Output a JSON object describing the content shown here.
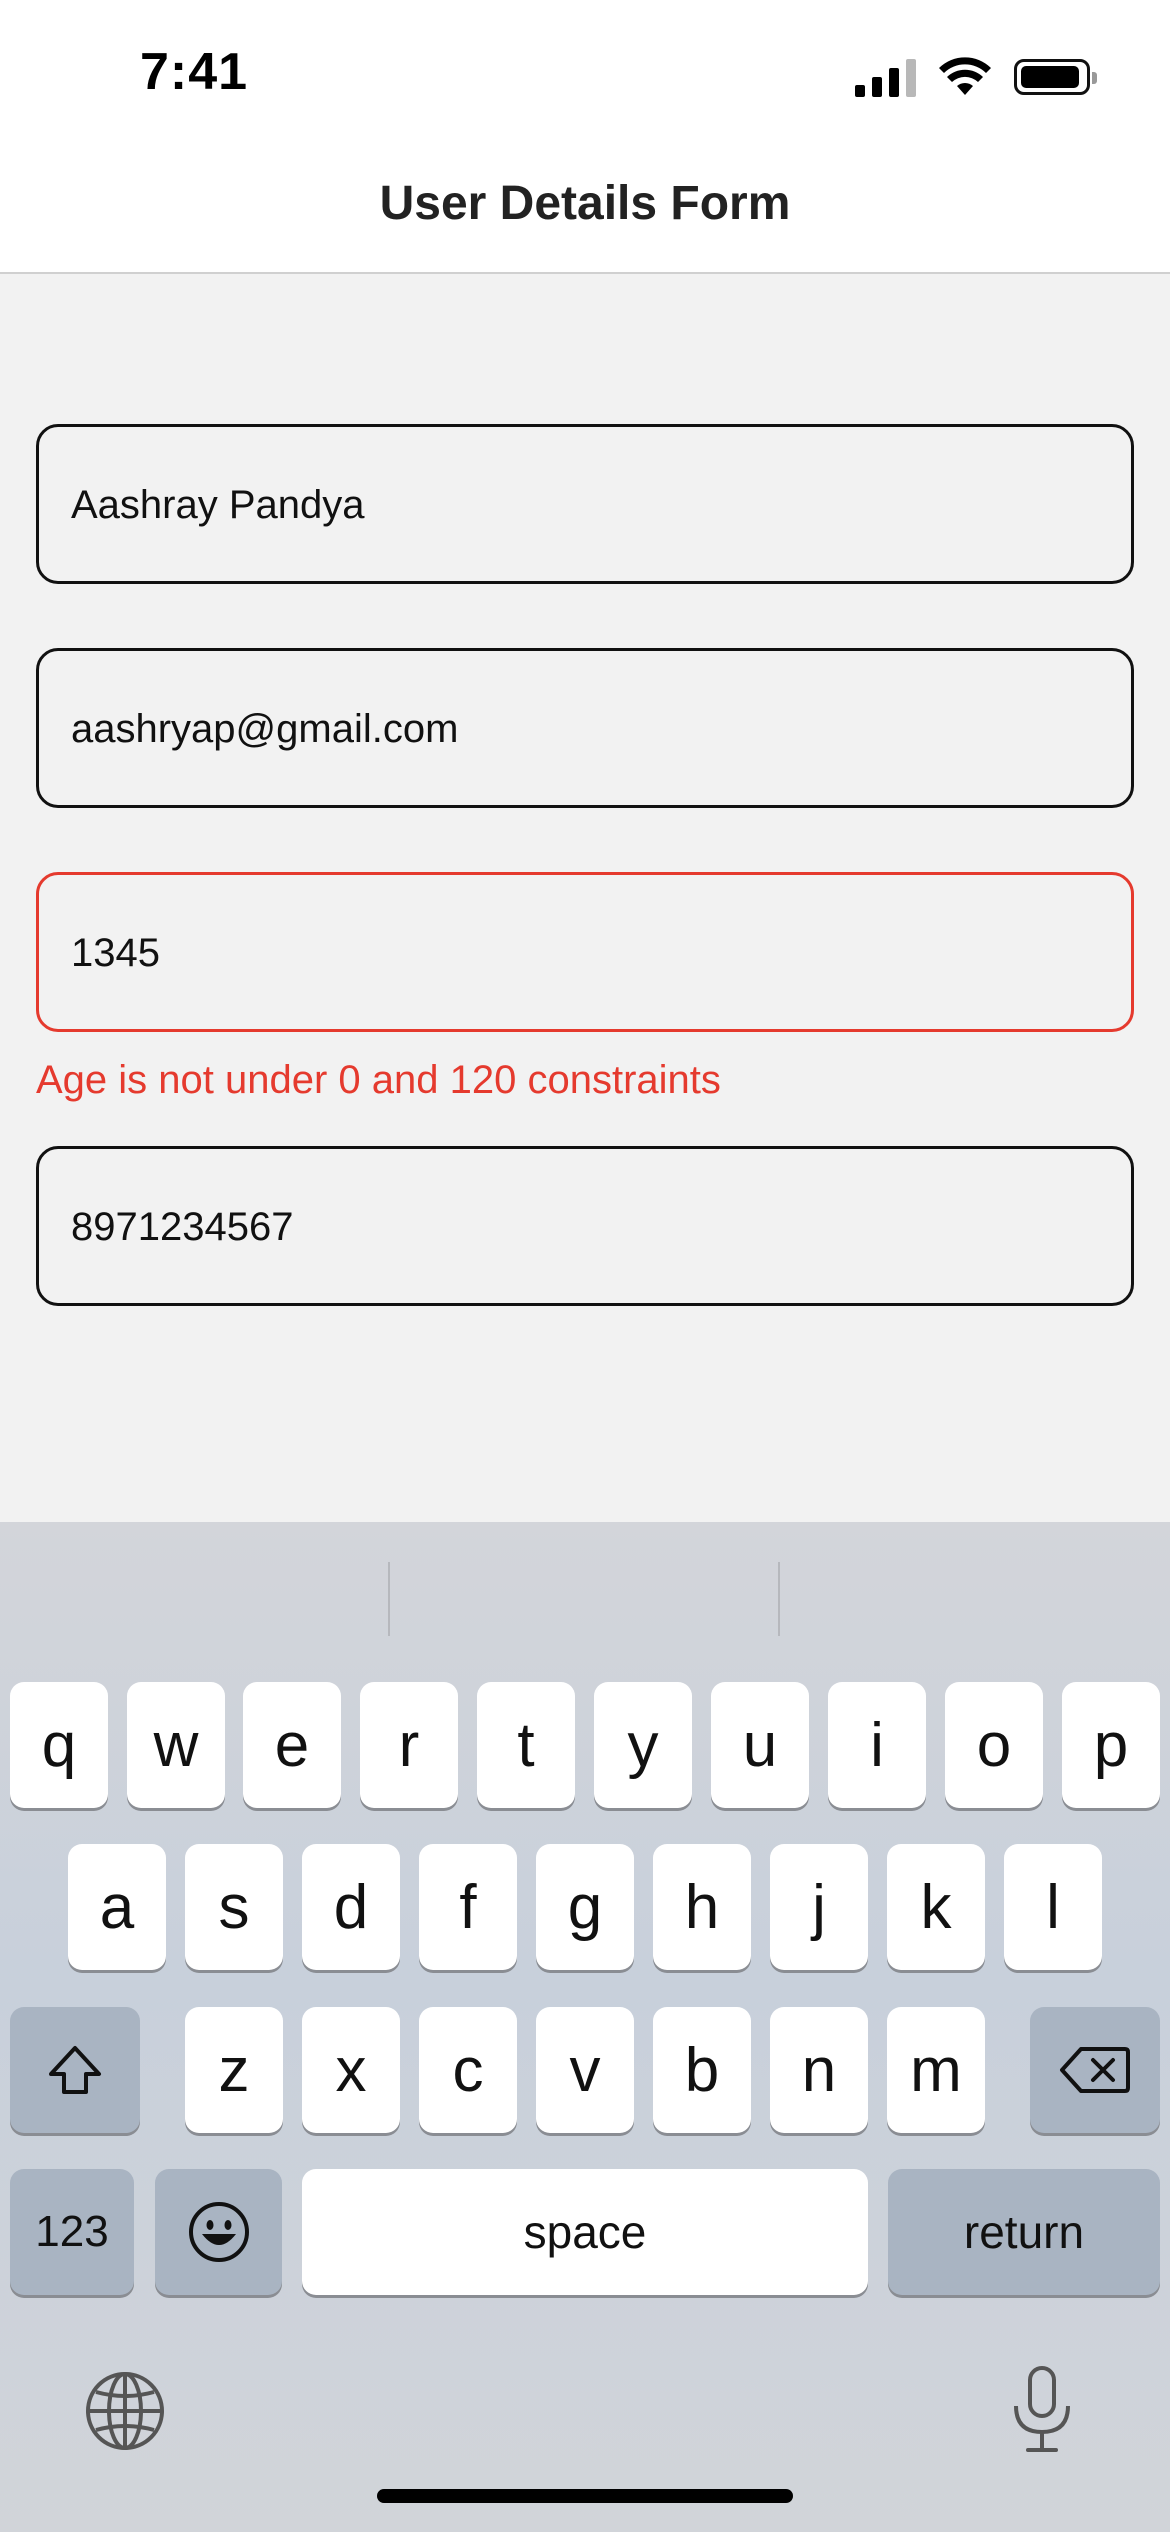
{
  "status_bar": {
    "time": "7:41"
  },
  "nav": {
    "title": "User Details Form"
  },
  "form": {
    "name_value": "Aashray Pandya",
    "email_value": "aashryap@gmail.com",
    "age_value": "1345",
    "age_error": "Age is not under 0 and 120 constraints",
    "phone_value": "8971234567"
  },
  "keyboard": {
    "row1": [
      "q",
      "w",
      "e",
      "r",
      "t",
      "y",
      "u",
      "i",
      "o",
      "p"
    ],
    "row2": [
      "a",
      "s",
      "d",
      "f",
      "g",
      "h",
      "j",
      "k",
      "l"
    ],
    "row3": [
      "z",
      "x",
      "c",
      "v",
      "b",
      "n",
      "m"
    ],
    "numbers_label": "123",
    "space_label": "space",
    "return_label": "return"
  },
  "colors": {
    "error": "#e53a2e",
    "special_key": "#a9b4c2"
  }
}
